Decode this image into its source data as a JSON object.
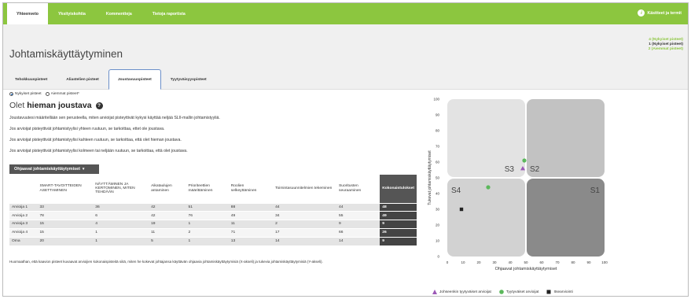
{
  "topnav": {
    "tabs": [
      "Yhteenveto",
      "Yksityiskohtia",
      "Kommentteja",
      "Tietoja raportista"
    ],
    "terms": "Käsitteet ja termit"
  },
  "header": {
    "title": "Johtamiskäyttäytyminen",
    "legend": [
      "4 (Nykyiset pisteet)",
      "1 (Nykyiset pisteet)",
      "2 (Aiemmat pisteet)"
    ]
  },
  "tabs": [
    "Tehokkuuspisteet",
    "Aliastelien pisteet",
    "Joustavuuspisteet",
    "Tyytyväisyyspisteet"
  ],
  "radios": {
    "current": "Nykyiset pisteet",
    "previous": "Aiemmat pisteet*"
  },
  "result": {
    "prefix": "Olet",
    "value": "hieman joustava",
    "help_icon": "question-icon"
  },
  "paragraphs": [
    "Joustavuutesi määritellään sen perusteella, miten arvioijat pisteyttivät kykysi käyttää neljää SLII-mallin johtamistyyliä.",
    "Jos arvioijat pisteyttivät johtamistyylisi yhteen ruutuun, se tarkoittaa, ettet ole joustava.",
    "Jos arvioijat pisteyttivät johtamistyylisi kahteen ruutuun, se tarkoittaa, että olet hieman joustava.",
    "Jos arvioijat pisteyttivät johtamistyylisi kolmeen tai neljään ruutuun, se tarkoittaa, että olet joustava."
  ],
  "dropdown": {
    "label": "Ohjaavat johtamiskäyttäytymiset",
    "icon": "chevron-down-icon"
  },
  "table": {
    "headers": [
      "",
      "SMART-TAVOITTEIDEN ASETTAMINEN",
      "NÄYTTÄMINEN JA KERTOMINEN, MITEN TEHDÄÄN",
      "Aikataulujen antaminen",
      "Prioriteettien määrittäminen",
      "Roolien selkeyttäminen",
      "Toimintasuunnitelmien tekeminen",
      "Suoritusten seuraaminen",
      "Kokonaistulokset"
    ],
    "rows": [
      [
        "Arvioija 1",
        "33",
        "36",
        "42",
        "51",
        "88",
        "44",
        "44",
        "48"
      ],
      [
        "Arvioija 2",
        "78",
        "6",
        "42",
        "76",
        "49",
        "34",
        "55",
        "49"
      ],
      [
        "Arvioija 3",
        "15",
        "4",
        "19",
        "1",
        "11",
        "2",
        "9",
        "9"
      ],
      [
        "Arvioija 4",
        "15",
        "1",
        "11",
        "2",
        "71",
        "17",
        "66",
        "26"
      ],
      [
        "Oma",
        "20",
        "1",
        "5",
        "1",
        "13",
        "14",
        "14",
        "9"
      ]
    ]
  },
  "note": "Huomaathan, että kaavion pisteet kuvaavat arvioijien kokonaispisteitä siitä, miten he kokevat johtajansa käyttävän ohjaavia johtamiskäyttäytymisiä (X-akseli) ja tukevia johtamiskäyttäytymisiä (Y-akseli).",
  "chart_data": {
    "type": "scatter",
    "xlabel": "Ohjaavat johtamiskäyttäytymiset",
    "ylabel": "Tukevat johtamiskäyttäytymiset",
    "xlim": [
      0,
      100
    ],
    "ylim": [
      0,
      100
    ],
    "ticks": [
      0,
      10,
      20,
      30,
      40,
      50,
      60,
      70,
      80,
      90,
      100
    ],
    "quadrants": [
      "S3",
      "S2",
      "S4",
      "S1"
    ],
    "series": [
      {
        "name": "Johseenkin tyytyväiset arvioijat",
        "color": "#9b59b6",
        "marker": "triangle",
        "points": [
          [
            48,
            56
          ]
        ]
      },
      {
        "name": "Tyytyväiset arvioijat",
        "color": "#5cb85c",
        "marker": "circle",
        "points": [
          [
            49,
            61
          ],
          [
            26,
            44
          ]
        ]
      },
      {
        "name": "Itsearviointi",
        "color": "#222222",
        "marker": "square",
        "points": [
          [
            9,
            30
          ]
        ]
      }
    ]
  }
}
